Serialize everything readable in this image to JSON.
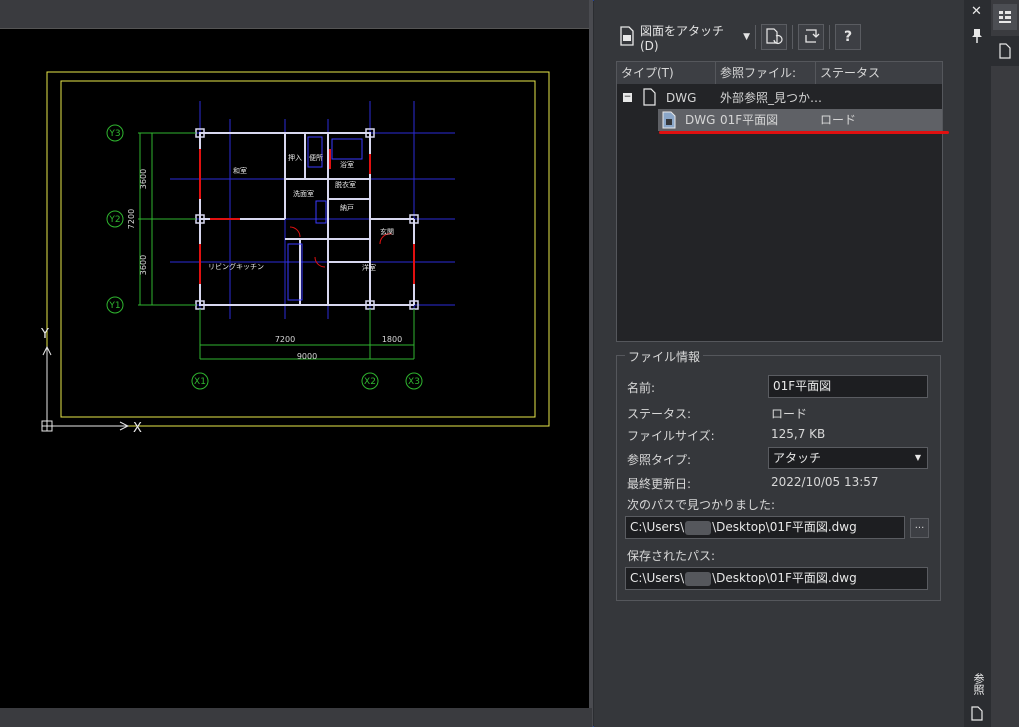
{
  "drawing": {
    "grid_labels": [
      "Y3",
      "Y2",
      "Y1",
      "X1",
      "X2",
      "X3"
    ],
    "rooms": [
      "和室",
      "押入",
      "便所",
      "浴室",
      "洗面室",
      "脱衣室",
      "納戸",
      "玄関",
      "リビングキッチン",
      "洋室"
    ],
    "dims_vertical": [
      "3600",
      "7200",
      "3600"
    ],
    "dims_horizontal": [
      "7200",
      "1800",
      "9000"
    ],
    "ucs_y": "Y",
    "ucs_x": "X"
  },
  "toolbar": {
    "attach_label": "図面をアタッチ(D)",
    "help_label": "?"
  },
  "list": {
    "columns": [
      "タイプ(T)",
      "参照ファイル:",
      "ステータス"
    ],
    "parent": {
      "type": "DWG",
      "file": "外部参照_見つか…"
    },
    "child": {
      "type": "DWG",
      "file": "01F平面図",
      "status": "ロード"
    }
  },
  "info": {
    "title": "ファイル情報",
    "name_label": "名前:",
    "name_value": "01F平面図",
    "status_label": "ステータス:",
    "status_value": "ロード",
    "size_label": "ファイルサイズ:",
    "size_value": "125,7 KB",
    "reftype_label": "参照タイプ:",
    "reftype_value": "アタッチ",
    "modified_label": "最終更新日:",
    "modified_value": "2022/10/05 13:57",
    "found_label": "次のパスで見つかりました:",
    "found_prefix": "C:\\Users\\",
    "found_suffix": "\\Desktop\\01F平面図.dwg",
    "browse_label": "...",
    "saved_label": "保存されたパス:",
    "saved_prefix": "C:\\Users\\",
    "saved_suffix": "\\Desktop\\01F平面図.dwg"
  },
  "sidebar": {
    "close_label": "✕",
    "vertical_title": "参照"
  },
  "colors": {
    "frame_yellow": "#e8e84a",
    "grid_green": "#2fb52f",
    "grid_blue": "#2b2bd8",
    "wall_white": "#d8d8f0",
    "highlight_red": "#e01010"
  }
}
